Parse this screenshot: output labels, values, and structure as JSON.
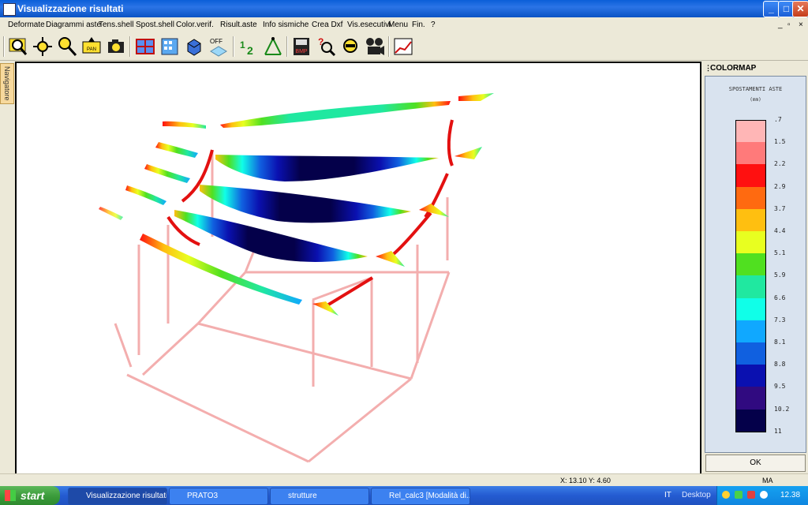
{
  "window": {
    "title": "Visualizzazione risultati",
    "controls": {
      "minimize": "_",
      "maximize": "□",
      "close": "✕"
    }
  },
  "menu": {
    "items": [
      "Deformate",
      "Diagrammi aste",
      "Tens.shell",
      "Spost.shell",
      "Color.verif.",
      "Risult.aste",
      "Info sismiche",
      "Crea Dxf",
      "Vis.esecutivi",
      "Menu",
      "Fin.",
      "?"
    ],
    "child_controls": [
      "_",
      "▫",
      "×"
    ]
  },
  "toolbar": {
    "icons": [
      "zoom-window-icon",
      "zoom-all-icon",
      "zoom-icon",
      "pan-icon",
      "camera-icon",
      "structure-view-icon",
      "building-icon",
      "solid-view-icon",
      "off-toggle-icon",
      "numbering-icon",
      "nodes-icon",
      "bmp-export-icon",
      "help-search-icon",
      "search-icon",
      "movie-icon",
      "chart-icon"
    ],
    "off_label": "OFF",
    "bmp_label": "BMP"
  },
  "navigator_tab": "Navigatore",
  "colormap": {
    "header": "COLORMAP",
    "title": "SPOSTAMENTI ASTE",
    "unit": "(mm)",
    "entries": [
      {
        "label": ".7",
        "color": "#ffb6b6"
      },
      {
        "label": "1.5",
        "color": "#ff7a7a"
      },
      {
        "label": "2.2",
        "color": "#ff1010"
      },
      {
        "label": "2.9",
        "color": "#ff6a10"
      },
      {
        "label": "3.7",
        "color": "#ffbf10"
      },
      {
        "label": "4.4",
        "color": "#e8ff20"
      },
      {
        "label": "5.1",
        "color": "#50e020"
      },
      {
        "label": "5.9",
        "color": "#20e8a0"
      },
      {
        "label": "6.6",
        "color": "#10ffe8"
      },
      {
        "label": "7.3",
        "color": "#10a8ff"
      },
      {
        "label": "8.1",
        "color": "#1060e0"
      },
      {
        "label": "8.8",
        "color": "#0a10b0"
      },
      {
        "label": "9.5",
        "color": "#300a80"
      },
      {
        "label": "10.2",
        "color": "#04004a"
      }
    ],
    "last_label": "11",
    "ok_label": "OK"
  },
  "status": {
    "coords": "X: 13.10  Y:  4.60",
    "mode": "MA"
  },
  "taskbar": {
    "start": "start",
    "tasks": [
      "Visualizzazione risultati",
      "PRATO3",
      "strutture",
      "Rel_calc3 [Modalità di..."
    ],
    "lang": "IT",
    "desktop": "Desktop",
    "time": "12.38"
  },
  "colors": {
    "titlebar": "#0a5fd8",
    "frame_lines": "#f2a0a0",
    "deformed_red": "#e31010"
  }
}
